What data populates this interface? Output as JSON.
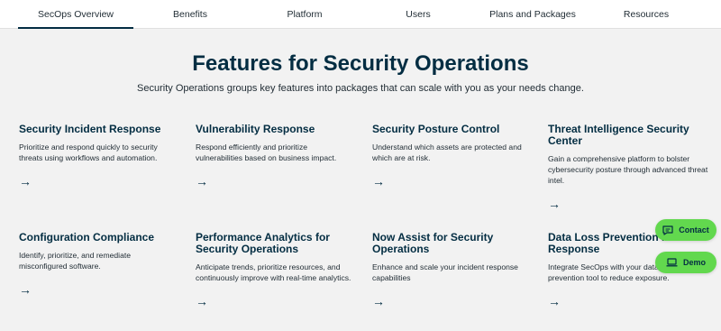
{
  "nav": {
    "tabs": [
      {
        "label": "SecOps Overview"
      },
      {
        "label": "Benefits"
      },
      {
        "label": "Platform"
      },
      {
        "label": "Users"
      },
      {
        "label": "Plans and Packages"
      },
      {
        "label": "Resources"
      }
    ],
    "active_index": 0
  },
  "hero": {
    "title": "Features for Security Operations",
    "subtitle": "Security Operations groups key features into packages that can scale with you as your needs change."
  },
  "features": [
    {
      "title": "Security Incident Response",
      "desc": "Prioritize and respond quickly to security threats using workflows and automation.",
      "arrow": "→"
    },
    {
      "title": "Vulnerability Response",
      "desc": "Respond efficiently and prioritize vulnerabilities based on business impact.",
      "arrow": "→"
    },
    {
      "title": "Security Posture Control",
      "desc": "Understand which assets are protected and which are at risk.",
      "arrow": "→"
    },
    {
      "title": "Threat Intelligence Security Center",
      "desc": "Gain a comprehensive platform to bolster cybersecurity posture through advanced threat intel.",
      "arrow": "→"
    },
    {
      "title": "Configuration Compliance",
      "desc": "Identify, prioritize, and remediate misconfigured software.",
      "arrow": "→"
    },
    {
      "title": "Performance Analytics for Security Operations",
      "desc": "Anticipate trends, prioritize resources, and continuously improve with real-time analytics.",
      "arrow": "→"
    },
    {
      "title": "Now Assist for Security Operations",
      "desc": "Enhance and scale your incident response capabilities",
      "arrow": "→"
    },
    {
      "title": "Data Loss Prevention Incident Response",
      "desc": "Integrate SecOps with your data loss prevention tool to reduce exposure.",
      "arrow": "→"
    }
  ],
  "floating": {
    "contact_label": "Contact",
    "demo_label": "Demo",
    "color": "#62d84e"
  },
  "colors": {
    "heading": "#032d42",
    "background": "#f2f2f2"
  }
}
